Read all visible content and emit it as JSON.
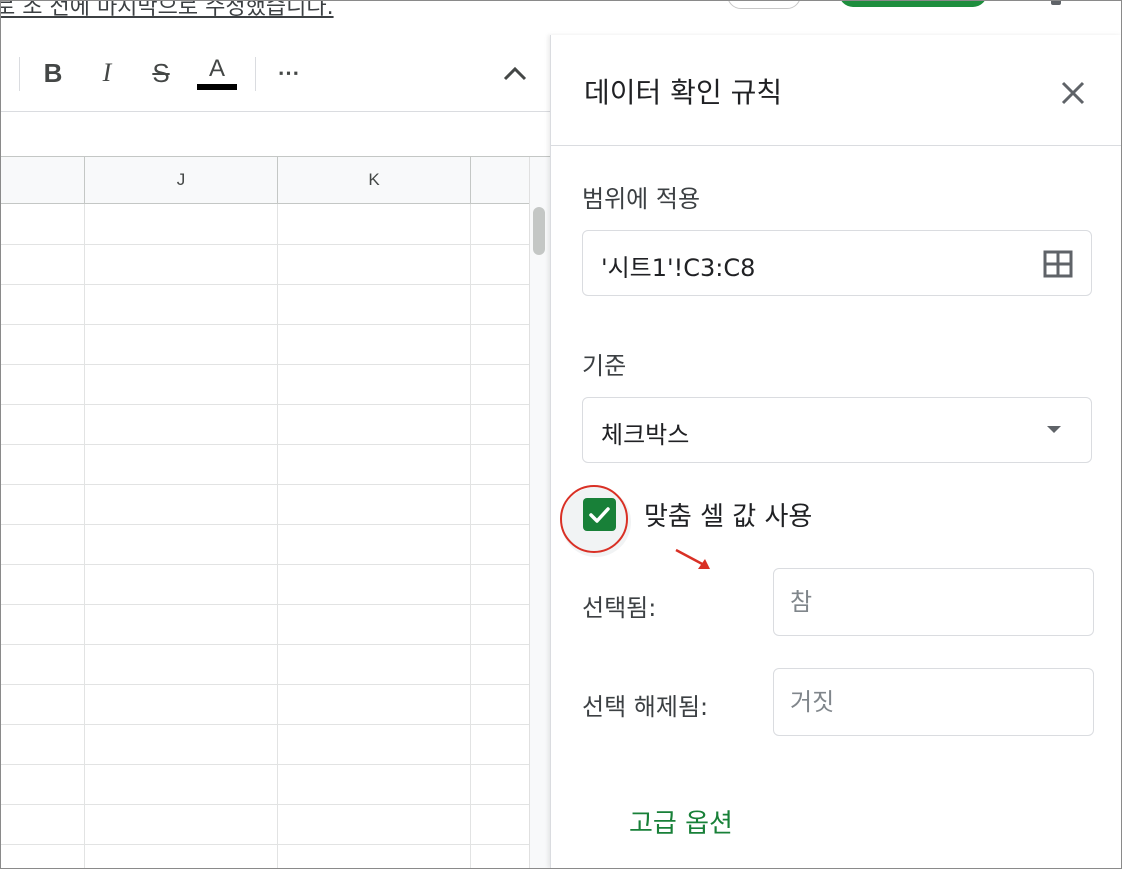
{
  "header": {
    "partial_text": "로 조 전에 마지막으로 수정했습니다."
  },
  "toolbar": {
    "bold_label": "B",
    "italic_label": "I",
    "strike_label": "S",
    "text_color_label": "A",
    "more_label": "⋯",
    "text_color": "#000000"
  },
  "sheet": {
    "columns": [
      "J",
      "K"
    ]
  },
  "panel": {
    "title": "데이터 확인 규칙",
    "range_label": "범위에 적용",
    "range_value": "'시트1'!C3:C8",
    "criteria_label": "기준",
    "criteria_value": "체크박스",
    "custom_values": {
      "checked": true,
      "label": "맞춤 셀 값 사용"
    },
    "checked_label": "선택됨:",
    "checked_placeholder": "참",
    "unchecked_label": "선택 해제됨:",
    "unchecked_placeholder": "거짓",
    "advanced_label": "고급 옵션"
  },
  "colors": {
    "accent_green": "#188038",
    "annotation_red": "#d93025"
  }
}
